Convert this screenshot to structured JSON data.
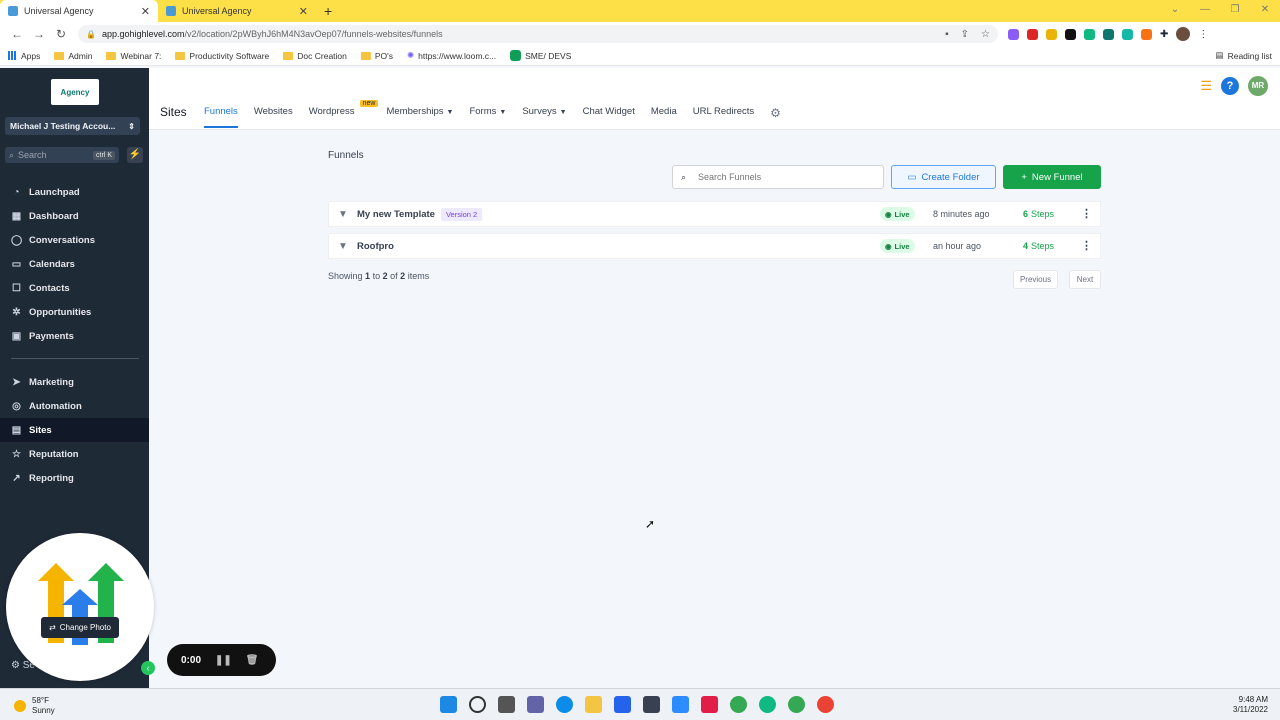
{
  "browser": {
    "tabs": [
      {
        "label": "Universal Agency",
        "active": true
      },
      {
        "label": "Universal Agency",
        "active": false
      }
    ],
    "url_host": "app.gohighlevel.com",
    "url_path": "/v2/location/2pWByhJ6hM4N3avOep07/funnels-websites/funnels",
    "bookmarks": [
      "Apps",
      "Admin",
      "Webinar 7:",
      "Productivity Software",
      "Doc Creation",
      "PO's",
      "https://www.loom.c...",
      "SME/ DEVS"
    ],
    "reading_list": "Reading list"
  },
  "sidebar": {
    "logo_text": "Agency",
    "account": "Michael J Testing Accou...",
    "search_placeholder": "Search",
    "search_shortcut": "ctrl K",
    "nav_top": [
      {
        "label": "Launchpad",
        "icon": "rocket-icon"
      },
      {
        "label": "Dashboard",
        "icon": "dashboard-icon"
      },
      {
        "label": "Conversations",
        "icon": "chat-icon"
      },
      {
        "label": "Calendars",
        "icon": "calendar-icon"
      },
      {
        "label": "Contacts",
        "icon": "contacts-icon"
      },
      {
        "label": "Opportunities",
        "icon": "opportunities-icon"
      },
      {
        "label": "Payments",
        "icon": "payments-icon"
      }
    ],
    "nav_bottom": [
      {
        "label": "Marketing",
        "icon": "send-icon"
      },
      {
        "label": "Automation",
        "icon": "automation-icon"
      },
      {
        "label": "Sites",
        "icon": "sites-icon",
        "active": true
      },
      {
        "label": "Reputation",
        "icon": "star-icon"
      },
      {
        "label": "Reporting",
        "icon": "chart-icon"
      }
    ],
    "settings_label": "Se"
  },
  "header": {
    "section_title": "Sites",
    "tabs": [
      {
        "label": "Funnels",
        "active": true
      },
      {
        "label": "Websites"
      },
      {
        "label": "Wordpress",
        "badge": "new"
      },
      {
        "label": "Memberships",
        "dropdown": true
      },
      {
        "label": "Forms",
        "dropdown": true
      },
      {
        "label": "Surveys",
        "dropdown": true
      },
      {
        "label": "Chat Widget"
      },
      {
        "label": "Media"
      },
      {
        "label": "URL Redirects"
      }
    ],
    "user_initials": "MR",
    "help": "?"
  },
  "main": {
    "title": "Funnels",
    "search_placeholder": "Search Funnels",
    "create_folder": "Create Folder",
    "new_funnel": "New Funnel",
    "funnels": [
      {
        "name": "My new Template",
        "version": "Version 2",
        "status": "Live",
        "updated": "8 minutes ago",
        "steps_count": "6",
        "steps_label": "Steps"
      },
      {
        "name": "Roofpro",
        "version": "",
        "status": "Live",
        "updated": "an hour ago",
        "steps_count": "4",
        "steps_label": "Steps"
      }
    ],
    "showing": {
      "prefix": "Showing",
      "from": "1",
      "to_word": "to",
      "to": "2",
      "of_word": "of",
      "total": "2",
      "suffix": "items"
    },
    "previous": "Previous",
    "next": "Next"
  },
  "overlay": {
    "change_photo": "Change Photo",
    "timer": "0:00"
  },
  "taskbar": {
    "temp": "58°F",
    "condition": "Sunny",
    "time": "9:48 AM",
    "date": "3/11/2022"
  },
  "colors": {
    "accent": "#1d76db",
    "success": "#16a34a",
    "sidebar": "#1f2a37",
    "tabstrip": "#fde047"
  }
}
